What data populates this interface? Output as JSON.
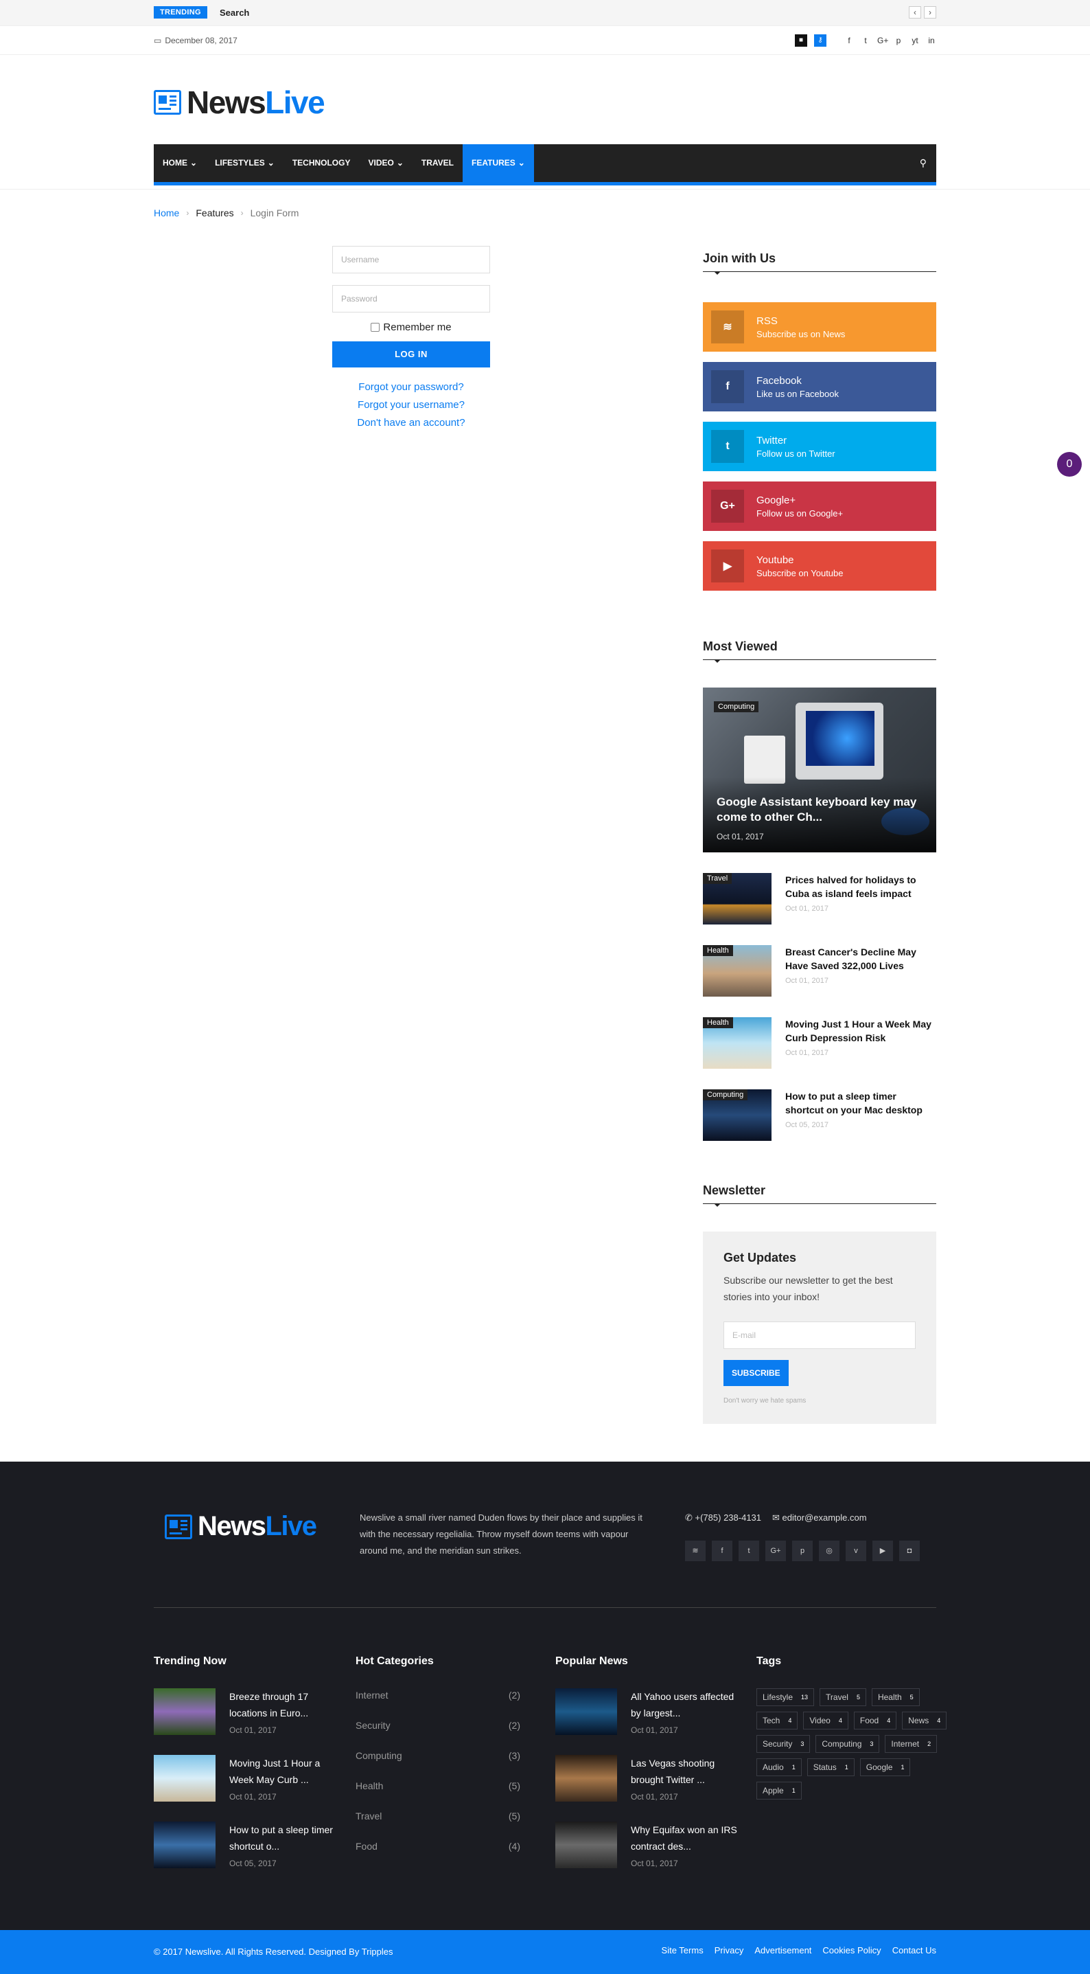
{
  "topbar": {
    "trending_label": "TRENDING",
    "search_label": "Search",
    "prev": "‹",
    "next": "›"
  },
  "datebar": {
    "date": "December 08, 2017",
    "social": [
      "f",
      "t",
      "G+",
      "p",
      "yt",
      "in"
    ]
  },
  "logo": {
    "part1": "News",
    "part2": "Live"
  },
  "nav": {
    "items": [
      {
        "label": "HOME",
        "caret": true
      },
      {
        "label": "LIFESTYLES",
        "caret": true
      },
      {
        "label": "TECHNOLOGY",
        "caret": false
      },
      {
        "label": "VIDEO",
        "caret": true
      },
      {
        "label": "TRAVEL",
        "caret": false
      },
      {
        "label": "FEATURES",
        "caret": true,
        "active": true
      }
    ]
  },
  "breadcrumb": {
    "home": "Home",
    "features": "Features",
    "current": "Login Form"
  },
  "login": {
    "username_placeholder": "Username",
    "password_placeholder": "Password",
    "remember": "Remember me",
    "button": "LOG IN",
    "forgot_password": "Forgot your password?",
    "forgot_username": "Forgot your username?",
    "register": "Don't have an account?"
  },
  "join": {
    "title": "Join with Us",
    "items": [
      {
        "name": "RSS",
        "sub": "Subscribe us on News",
        "color": "#f7982f",
        "icon": "rss-icon",
        "glyph": "≋"
      },
      {
        "name": "Facebook",
        "sub": "Like us on Facebook",
        "color": "#3b5998",
        "icon": "facebook-icon",
        "glyph": "f"
      },
      {
        "name": "Twitter",
        "sub": "Follow us on Twitter",
        "color": "#00abec",
        "icon": "twitter-icon",
        "glyph": "t"
      },
      {
        "name": "Google+",
        "sub": "Follow us on Google+",
        "color": "#c93545",
        "icon": "google-plus-icon",
        "glyph": "G+"
      },
      {
        "name": "Youtube",
        "sub": "Subscribe on Youtube",
        "color": "#e2493b",
        "icon": "youtube-icon",
        "glyph": "▶"
      }
    ]
  },
  "most_viewed": {
    "title": "Most Viewed",
    "featured": {
      "tag": "Computing",
      "title": "Google Assistant keyboard key may come to other Ch...",
      "date": "Oct 01, 2017"
    },
    "items": [
      {
        "tag": "Travel",
        "title": "Prices halved for holidays to Cuba as island feels impact",
        "date": "Oct 01, 2017"
      },
      {
        "tag": "Health",
        "title": "Breast Cancer's Decline May Have Saved 322,000 Lives",
        "date": "Oct 01, 2017"
      },
      {
        "tag": "Health",
        "title": "Moving Just 1 Hour a Week May Curb Depression Risk",
        "date": "Oct 01, 2017"
      },
      {
        "tag": "Computing",
        "title": "How to put a sleep timer shortcut on your Mac desktop",
        "date": "Oct 05, 2017"
      }
    ]
  },
  "newsletter": {
    "title": "Newsletter",
    "heading": "Get Updates",
    "text": "Subscribe our newsletter to get the best stories into your inbox!",
    "email_placeholder": "E-mail",
    "button": "SUBSCRIBE",
    "note": "Don't worry we hate spams"
  },
  "cart_count": "0",
  "footer": {
    "logo1": "News",
    "logo2": "Live",
    "desc": "Newslive a small river named Duden flows by their place and supplies it with the necessary regelialia. Throw myself down teems with vapour around me, and the meridian sun strikes.",
    "phone": "+(785) 238-4131",
    "email": "editor@example.com",
    "social": [
      "≋",
      "f",
      "t",
      "G+",
      "p",
      "◎",
      "v",
      "▶",
      "◘"
    ],
    "trending": {
      "title": "Trending Now",
      "items": [
        {
          "title": "Breeze through 17 locations in Euro...",
          "date": "Oct 01, 2017"
        },
        {
          "title": "Moving Just 1 Hour a Week May Curb ...",
          "date": "Oct 01, 2017"
        },
        {
          "title": "How to put a sleep timer shortcut o...",
          "date": "Oct 05, 2017"
        }
      ]
    },
    "categories": {
      "title": "Hot Categories",
      "items": [
        {
          "name": "Internet",
          "count": "(2)"
        },
        {
          "name": "Security",
          "count": "(2)"
        },
        {
          "name": "Computing",
          "count": "(3)"
        },
        {
          "name": "Health",
          "count": "(5)"
        },
        {
          "name": "Travel",
          "count": "(5)"
        },
        {
          "name": "Food",
          "count": "(4)"
        }
      ]
    },
    "popular": {
      "title": "Popular News",
      "items": [
        {
          "title": "All Yahoo users affected by largest...",
          "date": "Oct 01, 2017"
        },
        {
          "title": "Las Vegas shooting brought Twitter ...",
          "date": "Oct 01, 2017"
        },
        {
          "title": "Why Equifax won an IRS contract des...",
          "date": "Oct 01, 2017"
        }
      ]
    },
    "tags": {
      "title": "Tags",
      "items": [
        {
          "name": "Lifestyle",
          "n": "13"
        },
        {
          "name": "Travel",
          "n": "5"
        },
        {
          "name": "Health",
          "n": "5"
        },
        {
          "name": "Tech",
          "n": "4"
        },
        {
          "name": "Video",
          "n": "4"
        },
        {
          "name": "Food",
          "n": "4"
        },
        {
          "name": "News",
          "n": "4"
        },
        {
          "name": "Security",
          "n": "3"
        },
        {
          "name": "Computing",
          "n": "3"
        },
        {
          "name": "Internet",
          "n": "2"
        },
        {
          "name": "Audio",
          "n": "1"
        },
        {
          "name": "Status",
          "n": "1"
        },
        {
          "name": "Google",
          "n": "1"
        },
        {
          "name": "Apple",
          "n": "1"
        }
      ]
    }
  },
  "bottom": {
    "copyright": "© 2017 Newslive. All Rights Reserved. Designed By Tripples",
    "links": [
      "Site Terms",
      "Privacy",
      "Advertisement",
      "Cookies Policy",
      "Contact Us"
    ]
  }
}
